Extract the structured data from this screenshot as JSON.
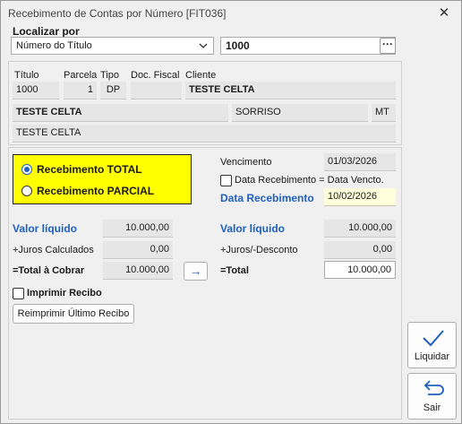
{
  "window": {
    "title": "Recebimento de Contas por Número [FIT036]"
  },
  "localizar": {
    "label": "Localizar por",
    "select_value": "Número do Título",
    "search_value": "1000",
    "ellipsis": "···"
  },
  "titulo": {
    "labels": {
      "titulo": "Título",
      "parcela": "Parcela",
      "tipo": "Tipo",
      "doc_fiscal": "Doc. Fiscal",
      "cliente": "Cliente"
    },
    "values": {
      "titulo": "1000",
      "parcela": "1",
      "tipo": "DP",
      "doc_fiscal": "",
      "cliente": "TESTE CELTA"
    },
    "address_name": "TESTE CELTA",
    "city": "SORRISO",
    "state": "MT",
    "extra": "TESTE CELTA"
  },
  "recebimento": {
    "total_label": "Recebimento TOTAL",
    "parcial_label": "Recebimento PARCIAL",
    "selected": "total"
  },
  "vencimento": {
    "label": "Vencimento",
    "value": "01/03/2026",
    "checkbox_label": "Data Recebimento = Data Vencto.",
    "checked": false,
    "data_receb_label": "Data Recebimento",
    "data_receb_value": "10/02/2026"
  },
  "left_values": {
    "valor_liquido_label": "Valor líquido",
    "valor_liquido": "10.000,00",
    "juros_label": "+Juros Calculados",
    "juros": "0,00",
    "total_label": "=Total à Cobrar",
    "total": "10.000,00"
  },
  "right_values": {
    "valor_liquido_label": "Valor líquido",
    "valor_liquido": "10.000,00",
    "juros_label": "+Juros/-Desconto",
    "juros": "0,00",
    "total_label": "=Total",
    "total": "10.000,00"
  },
  "arrow_button": "→",
  "imprimir": {
    "label": "Imprimir Recibo",
    "checked": false
  },
  "reimprimir_button": "Reimprimir Último Recibo",
  "side_buttons": {
    "liquidar": "Liquidar",
    "sair": "Sair"
  },
  "colors": {
    "accent_blue": "#1f5fbf",
    "highlight_yellow": "#ffff00",
    "date_yellow": "#ffffdc"
  },
  "icons": {
    "close": "close-icon",
    "checkmark": "checkmark-icon",
    "return": "return-arrow-icon",
    "arrow": "right-arrow-icon",
    "chevron": "chevron-down-icon"
  }
}
